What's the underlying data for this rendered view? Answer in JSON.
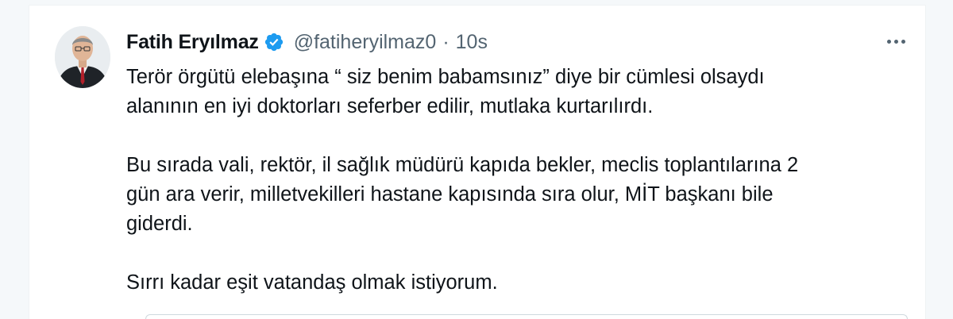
{
  "tweet": {
    "author": {
      "display_name": "Fatih Eryılmaz",
      "handle": "@fatiheryilmaz0",
      "verified": true,
      "avatar": "avatar-photo"
    },
    "separator": "·",
    "timestamp": "10s",
    "more_icon": "more-horizontal-icon",
    "text": {
      "line1": "Terör örgütü elebaşına “ siz benim babamsınız” diye bir cümlesi olsaydı",
      "line2": "alanının en iyi doktorları seferber edilir, mutlaka kurtarılırdı.",
      "line3": "Bu sırada vali, rektör, il sağlık müdürü kapıda bekler, meclis toplantılarına 2",
      "line4": "gün ara verir, milletvekilleri hastane kapısında sıra olur, MİT başkanı bile",
      "line5": "giderdi.",
      "line6": "Sırrı kadar eşit vatandaş olmak istiyorum."
    }
  },
  "colors": {
    "primary_text": "#0f1419",
    "secondary_text": "#536471",
    "verified_blue": "#1d9bf0",
    "background": "#ffffff"
  }
}
